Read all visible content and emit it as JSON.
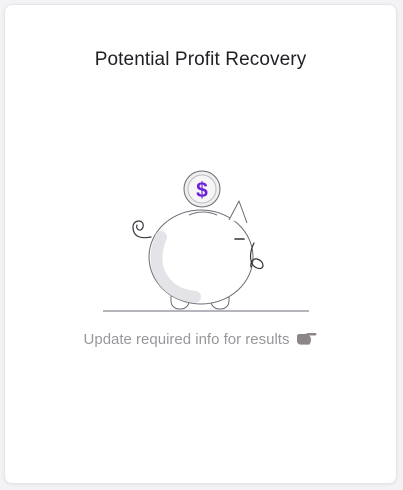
{
  "card": {
    "title": "Potential Profit Recovery",
    "hint_text": "Update required info for results"
  },
  "icons": {
    "illustration": "piggy-bank-with-dollar-coin",
    "hint_icon": "pointing-hand-right-icon"
  },
  "colors": {
    "accent": "#6b21d9",
    "title_text": "#1f1f24",
    "hint_text": "#9a979c",
    "illustration_stroke": "#5a5a66",
    "hand": "#8c8589"
  }
}
